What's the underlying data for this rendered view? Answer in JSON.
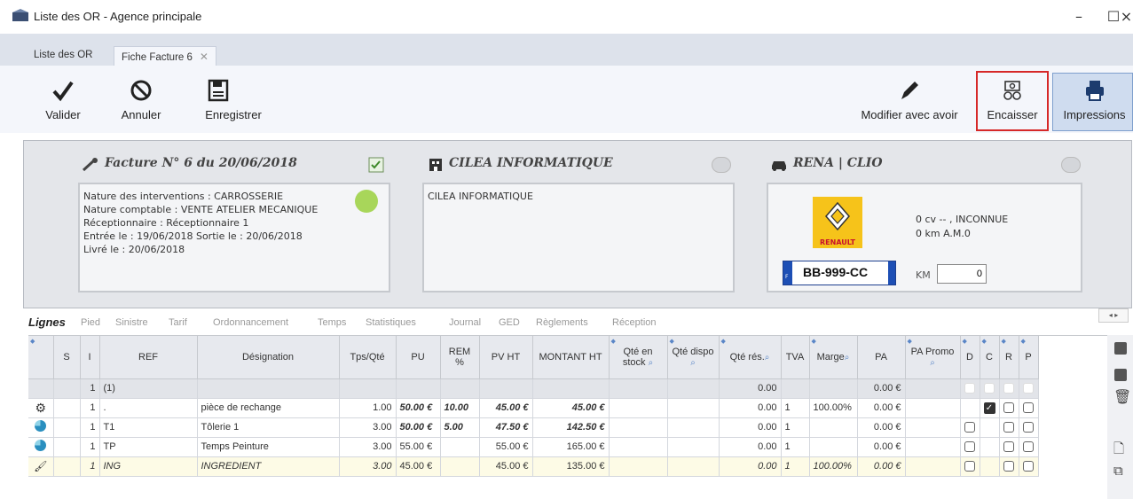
{
  "window": {
    "title": "Liste des OR - Agence principale",
    "minimize": "–",
    "maximize": "☐",
    "close": "×"
  },
  "tabs": [
    {
      "label": "Liste des OR"
    },
    {
      "label": "Fiche Facture 6",
      "close": "✕"
    }
  ],
  "toolbar": {
    "valider": "Valider",
    "annuler": "Annuler",
    "enregistrer": "Enregistrer",
    "modifier": "Modifier avec avoir",
    "encaisser": "Encaisser",
    "impressions": "Impressions"
  },
  "invoice": {
    "title": "Facture N° 6 du 20/06/2018",
    "lines": [
      "Nature des interventions : CARROSSERIE",
      "Nature comptable : VENTE ATELIER MECANIQUE",
      "Réceptionnaire  : Réceptionnaire 1",
      "Entrée le : 19/06/2018 Sortie  le : 20/06/2018",
      "Livré  le : 20/06/2018"
    ],
    "status_color": "#a8d65a"
  },
  "client": {
    "title": "CILEA INFORMATIQUE",
    "body": "CILEA INFORMATIQUE"
  },
  "vehicle": {
    "title": "RENA  |  CLIO",
    "brand_label": "RENAULT",
    "line1": "0 cv -- , INCONNUE",
    "line2": "0 km  A.M.0",
    "plate": "BB-999-CC",
    "plate_flag": "F",
    "km_label": "KM",
    "km_value": "0"
  },
  "subtabs": [
    "Lignes",
    "Pied",
    "Sinistre",
    "Tarif",
    "Ordonnancement",
    "Temps",
    "Statistiques",
    "Journal",
    "GED",
    "Règlements",
    "Réception"
  ],
  "grid": {
    "headers": [
      "S",
      "I",
      "REF",
      "Désignation",
      "Tps/Qté",
      "PU",
      "REM %",
      "PV HT",
      "MONTANT HT",
      "Qté en stock",
      "Qté dispo",
      "Qté rés.",
      "TVA",
      "Marge",
      "PA",
      "PA Promo",
      "D",
      "C",
      "R",
      "P"
    ],
    "total_row": {
      "i": "1",
      "ref": "(1)",
      "qte_res": "0.00",
      "pa": "0.00 €"
    },
    "rows": [
      {
        "icon": "gear-icon",
        "i": "1",
        "ref": ".",
        "designation": "pièce de rechange",
        "tps": "1.00",
        "pu": "50.00 €",
        "rem": "10.00",
        "pvht": "45.00 €",
        "montant": "45.00 €",
        "qte_res": "0.00",
        "tva": "1",
        "marge": "100.00%",
        "pa": "0.00 €",
        "c_checked": true
      },
      {
        "icon": "pie-icon",
        "i": "1",
        "ref": "T1",
        "designation": "Tôlerie 1",
        "tps": "3.00",
        "pu": "50.00 €",
        "rem": "5.00",
        "pvht": "47.50 €",
        "montant": "142.50 €",
        "qte_res": "0.00",
        "tva": "1",
        "marge": "",
        "pa": "0.00 €",
        "c_checked": false
      },
      {
        "icon": "pie-icon",
        "i": "1",
        "ref": "TP",
        "designation": "Temps Peinture",
        "tps": "3.00",
        "pu": "55.00 €",
        "rem": "",
        "pvht": "55.00 €",
        "montant": "165.00 €",
        "qte_res": "0.00",
        "tva": "1",
        "marge": "",
        "pa": "0.00 €",
        "c_checked": false
      },
      {
        "icon": "brush-icon",
        "i": "1",
        "ref": "ING",
        "designation": "INGREDIENT",
        "tps": "3.00",
        "pu": "45.00 €",
        "rem": "",
        "pvht": "45.00 €",
        "montant": "135.00 €",
        "qte_res": "0.00",
        "tva": "1",
        "marge": "100.00%",
        "pa": "0.00 €",
        "c_checked": false
      }
    ]
  },
  "nav_arrows": "◂ ▸"
}
